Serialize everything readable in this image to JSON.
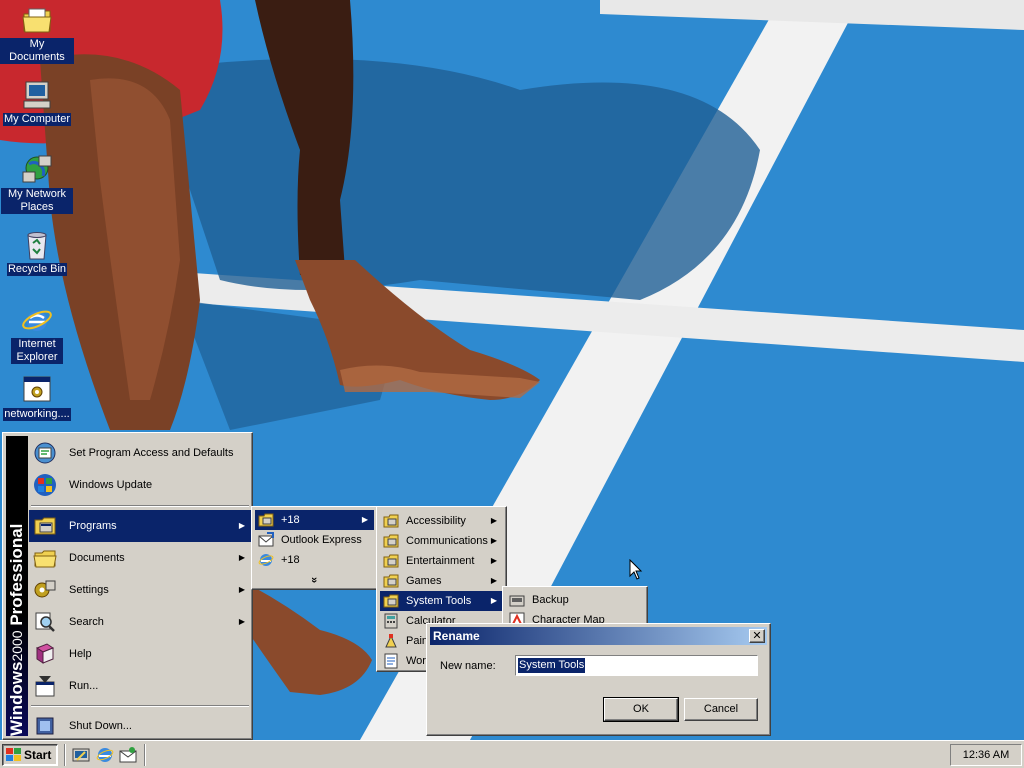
{
  "desktop_icons": [
    {
      "name": "my-documents-icon",
      "label": "My Documents"
    },
    {
      "name": "my-computer-icon",
      "label": "My Computer"
    },
    {
      "name": "my-network-places-icon",
      "label": "My Network Places"
    },
    {
      "name": "recycle-bin-icon",
      "label": "Recycle Bin"
    },
    {
      "name": "internet-explorer-icon",
      "label": "Internet Explorer"
    },
    {
      "name": "networking-shortcut-icon",
      "label": "networking...."
    }
  ],
  "start_menu": {
    "banner_bold": "Windows",
    "banner_light": "2000",
    "banner_edition": "Professional",
    "top_items": [
      {
        "label": "Set Program Access and Defaults",
        "icon": "program-access-icon"
      },
      {
        "label": "Windows Update",
        "icon": "windows-update-icon"
      }
    ],
    "items": [
      {
        "label": "Programs",
        "icon": "programs-folder-icon",
        "has_submenu": true,
        "selected": true
      },
      {
        "label": "Documents",
        "icon": "documents-folder-icon",
        "has_submenu": true
      },
      {
        "label": "Settings",
        "icon": "settings-icon",
        "has_submenu": true
      },
      {
        "label": "Search",
        "icon": "search-icon",
        "has_submenu": true
      },
      {
        "label": "Help",
        "icon": "help-book-icon"
      },
      {
        "label": "Run...",
        "icon": "run-icon"
      }
    ],
    "shutdown": {
      "label": "Shut Down...",
      "icon": "shutdown-icon"
    }
  },
  "programs_menu": {
    "items": [
      {
        "label": "+18",
        "icon": "program-group-icon",
        "has_submenu": true,
        "selected": true
      },
      {
        "label": "Outlook Express",
        "icon": "outlook-express-icon"
      },
      {
        "label": "+18",
        "icon": "internet-explorer-icon"
      }
    ],
    "expand_glyph": "»"
  },
  "accessories_menu": {
    "items": [
      {
        "label": "Accessibility",
        "icon": "program-group-icon",
        "has_submenu": true
      },
      {
        "label": "Communications",
        "icon": "program-group-icon",
        "has_submenu": true
      },
      {
        "label": "Entertainment",
        "icon": "program-group-icon",
        "has_submenu": true
      },
      {
        "label": "Games",
        "icon": "program-group-icon",
        "has_submenu": true
      },
      {
        "label": "System Tools",
        "icon": "program-group-icon",
        "has_submenu": true,
        "selected": true
      },
      {
        "label": "Calculator",
        "icon": "calculator-icon"
      },
      {
        "label": "Pain",
        "icon": "paint-icon"
      },
      {
        "label": "Wor",
        "icon": "wordpad-icon"
      }
    ]
  },
  "system_tools_menu": {
    "items": [
      {
        "label": "Backup",
        "icon": "backup-icon"
      },
      {
        "label": "Character Map",
        "icon": "character-map-icon"
      }
    ]
  },
  "rename_dialog": {
    "title": "Rename",
    "close_glyph": "✕",
    "new_name_label": "New name:",
    "value": "System Tools",
    "ok_label": "OK",
    "cancel_label": "Cancel"
  },
  "taskbar": {
    "start_label": "Start",
    "quick_launch": [
      "show-desktop-icon",
      "internet-explorer-icon",
      "outlook-express-icon"
    ],
    "clock": "12:36 AM"
  },
  "colors": {
    "selection": "#0a246a",
    "face": "#d4d0c8",
    "track_blue": "#2a86c8"
  }
}
